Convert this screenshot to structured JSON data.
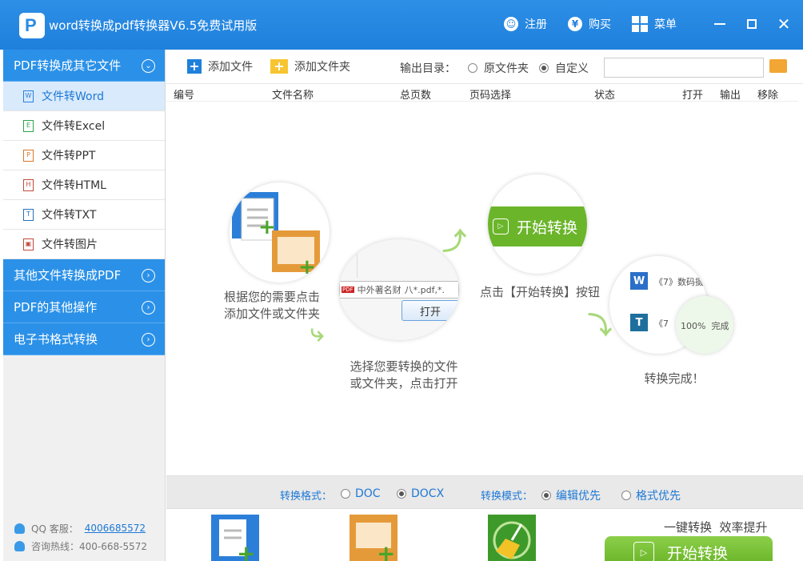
{
  "window": {
    "title": "word转换成pdf转换器V6.5免费试用版",
    "logo_letter": "P"
  },
  "titlebar": {
    "register": "注册",
    "buy": "购买",
    "menu": "菜单",
    "register_glyph": "☺",
    "buy_glyph": "¥"
  },
  "sidebar": {
    "sections": [
      {
        "label": "PDF转换成其它文件",
        "expanded": true
      },
      {
        "label": "其他文件转换成PDF",
        "expanded": false
      },
      {
        "label": "PDF的其他操作",
        "expanded": false
      },
      {
        "label": "电子书格式转换",
        "expanded": false
      }
    ],
    "items": [
      {
        "label": "文件转Word",
        "icon": "word-file-icon",
        "glyph": "W",
        "color": "#2a7fd8"
      },
      {
        "label": "文件转Excel",
        "icon": "excel-file-icon",
        "glyph": "E",
        "color": "#2da34a"
      },
      {
        "label": "文件转PPT",
        "icon": "ppt-file-icon",
        "glyph": "P",
        "color": "#d8782a"
      },
      {
        "label": "文件转HTML",
        "icon": "html-file-icon",
        "glyph": "H",
        "color": "#c24a3a"
      },
      {
        "label": "文件转TXT",
        "icon": "txt-file-icon",
        "glyph": "T",
        "color": "#2a6fb8"
      },
      {
        "label": "文件转图片",
        "icon": "image-file-icon",
        "glyph": "▣",
        "color": "#c24a3a"
      }
    ],
    "footer": {
      "qq_label": "QQ 客服：",
      "qq_number": "4006685572",
      "hotline": "咨询热线：400-668-5572"
    }
  },
  "toolbar": {
    "add_file": "添加文件",
    "add_folder": "添加文件夹",
    "output_label": "输出目录：",
    "opt_original": "原文件夹",
    "opt_custom": "自定义",
    "selected": "custom",
    "output_path": ""
  },
  "table": {
    "columns": [
      "编号",
      "文件名称",
      "总页数",
      "页码选择",
      "状态",
      "打开",
      "输出",
      "移除"
    ],
    "rows": []
  },
  "guide": {
    "step1": "根据您的需要点击\n添加文件或文件夹",
    "step2": "选择您要转换的文件\n或文件夹，点击打开",
    "step3": "点击【开始转换】按钮",
    "step4": "转换完成！",
    "step2_file": "中外著名财",
    "step2_ext": "八*.pdf,*.",
    "step2_open": "打开",
    "step3_button": "开始转换",
    "step4_doc1": "《7》数码摄",
    "step4_doc2": "《7",
    "step4_progress": "100%  完成"
  },
  "bottom": {
    "format_label": "转换格式：",
    "format_options": [
      "DOC",
      "DOCX"
    ],
    "format_selected": "DOCX",
    "mode_label": "转换模式：",
    "mode_options": [
      "编辑优先",
      "格式优先"
    ],
    "mode_selected": "编辑优先",
    "slogan": "一键转换  效率提升",
    "start_button": "开始转换"
  },
  "colors": {
    "accent": "#1f80dc",
    "green": "#6bb52b"
  }
}
